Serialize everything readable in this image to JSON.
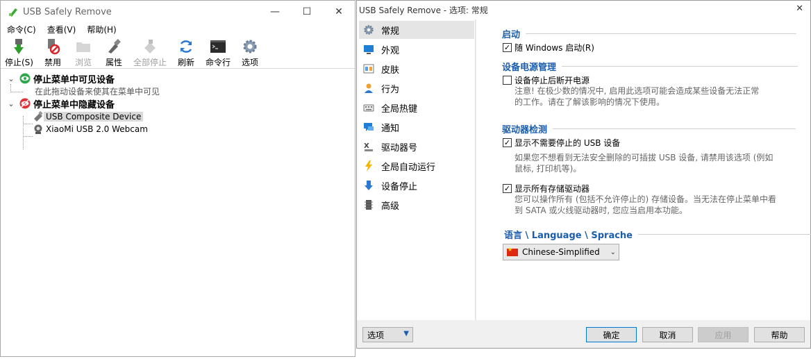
{
  "main_window": {
    "title": "USB Safely Remove",
    "controls": {
      "minimize": "—",
      "maximize": "☐",
      "close": "✕"
    },
    "menu": [
      "命令(C)",
      "查看(V)",
      "帮助(H)"
    ],
    "toolbar": [
      {
        "label": "停止(S)",
        "icon": "stop-icon",
        "enabled": true
      },
      {
        "label": "禁用",
        "icon": "disable-icon",
        "enabled": true
      },
      {
        "label": "浏览",
        "icon": "folder-icon",
        "enabled": false
      },
      {
        "label": "属性",
        "icon": "properties-icon",
        "enabled": true
      },
      {
        "label": "全部停止",
        "icon": "stop-all-icon",
        "enabled": false
      },
      {
        "label": "刷新",
        "icon": "refresh-icon",
        "enabled": true
      },
      {
        "label": "命令行",
        "icon": "terminal-icon",
        "enabled": true
      },
      {
        "label": "选项",
        "icon": "gear-icon",
        "enabled": true
      }
    ],
    "tree": {
      "visible_group": {
        "title": "停止菜单中可见设备",
        "hint": "在此拖动设备来使其在菜单中可见"
      },
      "hidden_group": {
        "title": "停止菜单中隐藏设备",
        "devices": [
          "USB Composite Device",
          "XiaoMi USB 2.0 Webcam"
        ]
      }
    }
  },
  "dialog": {
    "title": "USB Safely Remove - 选项: 常规",
    "close": "✕",
    "nav": [
      {
        "label": "常规",
        "icon": "gear-icon",
        "selected": true
      },
      {
        "label": "外观",
        "icon": "monitor-icon"
      },
      {
        "label": "皮肤",
        "icon": "skin-icon"
      },
      {
        "label": "行为",
        "icon": "user-icon"
      },
      {
        "label": "全局热键",
        "icon": "keyboard-icon"
      },
      {
        "label": "通知",
        "icon": "notification-icon"
      },
      {
        "label": "驱动器号",
        "icon": "drive-letter-icon"
      },
      {
        "label": "全局自动运行",
        "icon": "lightning-icon"
      },
      {
        "label": "设备停止",
        "icon": "arrow-down-icon"
      },
      {
        "label": "高级",
        "icon": "chip-icon"
      }
    ],
    "sections": {
      "startup": {
        "title": "启动",
        "option": {
          "label": "随 Windows 启动(R)",
          "checked": true
        }
      },
      "power": {
        "title": "设备电源管理",
        "option": {
          "label": "设备停止后断开电源",
          "checked": false
        },
        "desc_line1": "注意! 在极少数的情况中, 启用此选项可能会造成某些设备无法正常",
        "desc_line2": "的工作。请在了解该影响的情况下使用。"
      },
      "detect": {
        "title": "驱动器检测",
        "option1": {
          "label": "显示不需要停止的 USB 设备",
          "checked": true
        },
        "desc1_line1": "如果您不想看到无法安全删除的可插拔 USB 设备, 请禁用该选项 (例如",
        "desc1_line2": "鼠标, 打印机等)。",
        "option2": {
          "label": "显示所有存储驱动器",
          "checked": true
        },
        "desc2_line1": "您可以操作所有 (包括不允许停止的) 存储设备。当无法在停止菜单中看",
        "desc2_line2": "到 SATA 或火线驱动器时, 您应当启用本功能。"
      },
      "language": {
        "title": "语言 \\ Language \\ Sprache",
        "selected": "Chinese-Simplified"
      }
    },
    "footer": {
      "options_dropdown": "选项",
      "ok": "确定",
      "cancel": "取消",
      "apply": "应用",
      "help": "帮助"
    }
  }
}
